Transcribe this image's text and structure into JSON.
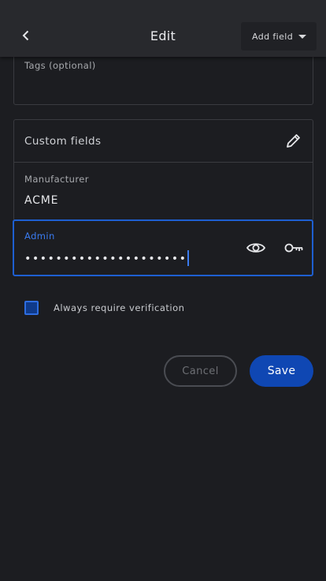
{
  "header": {
    "title": "Edit",
    "add_field_label": "Add field"
  },
  "tags": {
    "label": "Tags (optional)",
    "value": ""
  },
  "custom_fields": {
    "title": "Custom fields",
    "manufacturer": {
      "label": "Manufacturer",
      "value": "ACME"
    },
    "admin": {
      "label": "Admin",
      "value": "•••••••••••••••••••••"
    }
  },
  "verification": {
    "label": "Always require verification",
    "checked": true
  },
  "actions": {
    "cancel_label": "Cancel",
    "save_label": "Save"
  },
  "colors": {
    "accent": "#1e5fd1",
    "save_button": "#0f47b3",
    "background": "#1c1d21",
    "topbar": "#28292d"
  },
  "icons": [
    "chevron-left-icon",
    "caret-down-icon",
    "pencil-icon",
    "eye-icon",
    "key-icon"
  ]
}
